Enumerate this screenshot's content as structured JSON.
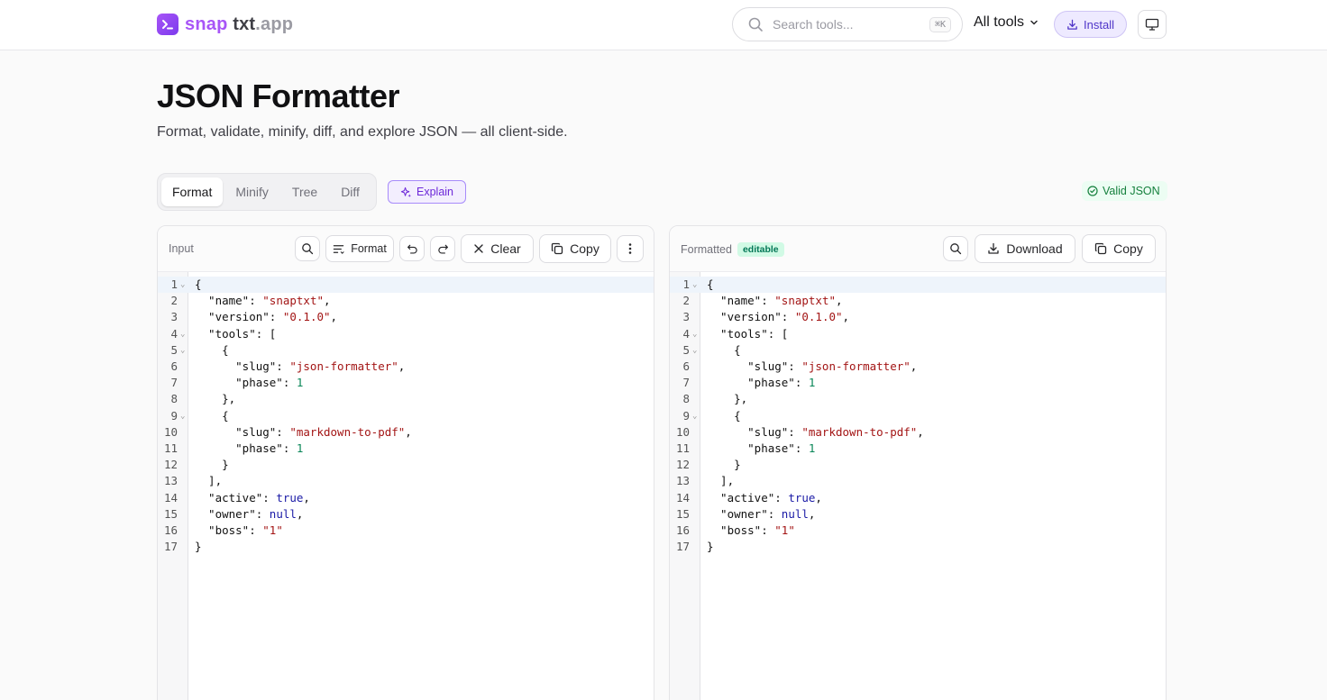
{
  "header": {
    "logo": {
      "part1": "snap",
      "part2": "txt",
      "part3": ".app"
    },
    "search": {
      "placeholder": "Search tools...",
      "shortcut": "⌘K"
    },
    "all_tools": "All tools",
    "install": "Install"
  },
  "page": {
    "title": "JSON Formatter",
    "subtitle": "Format, validate, minify, diff, and explore JSON — all client-side."
  },
  "modes": {
    "tabs": [
      "Format",
      "Minify",
      "Tree",
      "Diff"
    ],
    "active": "Format",
    "explain": "Explain"
  },
  "status": {
    "valid": "Valid JSON",
    "color": "#15803d"
  },
  "input_panel": {
    "label": "Input",
    "format": "Format",
    "clear": "Clear",
    "copy": "Copy"
  },
  "output_panel": {
    "label": "Formatted",
    "badge": "editable",
    "download": "Download",
    "copy": "Copy"
  },
  "code": {
    "lines": [
      "{",
      "  \"name\": \"snaptxt\",",
      "  \"version\": \"0.1.0\",",
      "  \"tools\": [",
      "    {",
      "      \"slug\": \"json-formatter\",",
      "      \"phase\": 1",
      "    },",
      "    {",
      "      \"slug\": \"markdown-to-pdf\",",
      "      \"phase\": 1",
      "    }",
      "  ],",
      "  \"active\": true,",
      "  \"owner\": null,",
      "  \"boss\": \"1\"",
      "}"
    ],
    "foldable_lines": [
      1,
      4,
      5,
      9
    ]
  },
  "colors": {
    "accent": "#7c3aed",
    "string": "#a31515",
    "number": "#098658",
    "keyword": "#1a1aa6"
  }
}
